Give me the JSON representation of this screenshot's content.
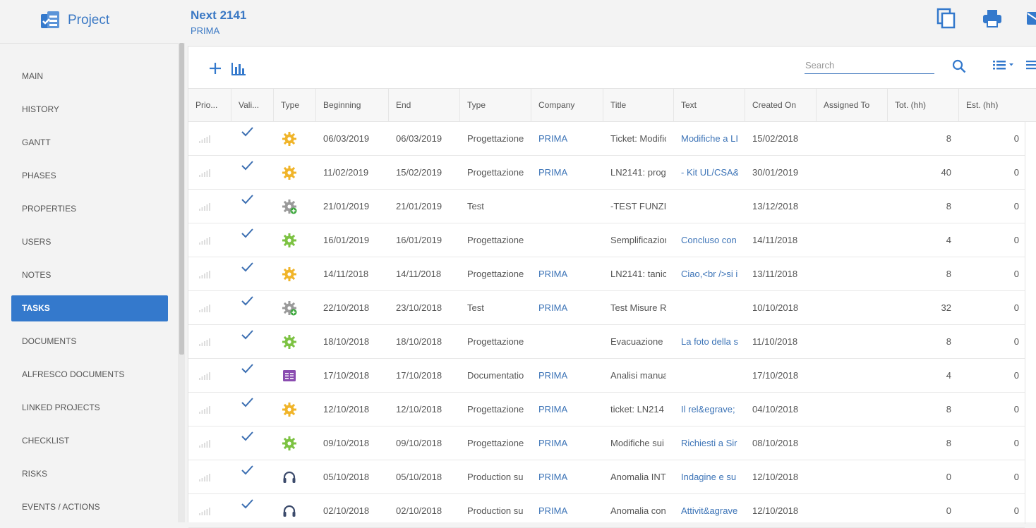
{
  "header": {
    "app_name": "Project",
    "project_title": "Next 2141",
    "project_subtitle": "PRIMA",
    "icons": [
      "copy-icon",
      "print-icon",
      "mail-icon"
    ]
  },
  "sidebar": {
    "items": [
      {
        "label": "MAIN",
        "active": false
      },
      {
        "label": "HISTORY",
        "active": false
      },
      {
        "label": "GANTT",
        "active": false
      },
      {
        "label": "PHASES",
        "active": false
      },
      {
        "label": "PROPERTIES",
        "active": false
      },
      {
        "label": "USERS",
        "active": false
      },
      {
        "label": "NOTES",
        "active": false
      },
      {
        "label": "TASKS",
        "active": true
      },
      {
        "label": "DOCUMENTS",
        "active": false
      },
      {
        "label": "ALFRESCO DOCUMENTS",
        "active": false
      },
      {
        "label": "LINKED PROJECTS",
        "active": false
      },
      {
        "label": "CHECKLIST",
        "active": false
      },
      {
        "label": "RISKS",
        "active": false
      },
      {
        "label": "EVENTS / ACTIONS",
        "active": false
      }
    ]
  },
  "toolbar": {
    "icons": [
      "add-icon",
      "bar-chart-icon",
      "search-icon",
      "list-view-icon",
      "menu-icon"
    ],
    "search_placeholder": "Search"
  },
  "colors": {
    "accent": "#3479cc",
    "link": "#3d74b7",
    "gear_orange": "#f0b429",
    "gear_green": "#7cc242",
    "gear_gray": "#9a9a9a",
    "doc_purple": "#8a4cb0",
    "support_navy": "#3b4a6b"
  },
  "table": {
    "columns": [
      "Prio...",
      "Vali...",
      "Type",
      "Beginning",
      "End",
      "Type",
      "Company",
      "Title",
      "Text",
      "Created On",
      "Assigned To",
      "Tot. (hh)",
      "Est. (hh)"
    ],
    "rows": [
      {
        "icon": "gear-orange",
        "beginning": "06/03/2019",
        "end": "06/03/2019",
        "type": "Progettazione",
        "company": "PRIMA",
        "title": "Ticket: Modific",
        "text": "Modifiche a LI",
        "created": "15/02/2018",
        "assigned": "",
        "tot": "8",
        "est": "0"
      },
      {
        "icon": "gear-orange",
        "beginning": "11/02/2019",
        "end": "15/02/2019",
        "type": "Progettazione",
        "company": "PRIMA",
        "title": "LN2141: prog",
        "text": "- Kit UL/CSA&",
        "created": "30/01/2019",
        "assigned": "",
        "tot": "40",
        "est": "0"
      },
      {
        "icon": "gear-test",
        "beginning": "21/01/2019",
        "end": "21/01/2019",
        "type": "Test",
        "company": "",
        "title": "-TEST FUNZI",
        "text": "",
        "created": "13/12/2018",
        "assigned": "",
        "tot": "8",
        "est": "0"
      },
      {
        "icon": "gear-green",
        "beginning": "16/01/2019",
        "end": "16/01/2019",
        "type": "Progettazione",
        "company": "",
        "title": "Semplificazior",
        "text": "Concluso con",
        "created": "14/11/2018",
        "assigned": "",
        "tot": "4",
        "est": "0"
      },
      {
        "icon": "gear-orange",
        "beginning": "14/11/2018",
        "end": "14/11/2018",
        "type": "Progettazione",
        "company": "PRIMA",
        "title": "LN2141: tanic",
        "text": "Ciao,<br />si i",
        "created": "13/11/2018",
        "assigned": "",
        "tot": "8",
        "est": "0"
      },
      {
        "icon": "gear-test",
        "beginning": "22/10/2018",
        "end": "23/10/2018",
        "type": "Test",
        "company": "PRIMA",
        "title": "Test Misure R",
        "text": "",
        "created": "10/10/2018",
        "assigned": "",
        "tot": "32",
        "est": "0"
      },
      {
        "icon": "gear-green",
        "beginning": "18/10/2018",
        "end": "18/10/2018",
        "type": "Progettazione",
        "company": "",
        "title": "Evacuazione",
        "text": "La foto della s",
        "created": "11/10/2018",
        "assigned": "",
        "tot": "8",
        "est": "0"
      },
      {
        "icon": "document",
        "beginning": "17/10/2018",
        "end": "17/10/2018",
        "type": "Documentatio",
        "company": "PRIMA",
        "title": "Analisi manua",
        "text": "",
        "created": "17/10/2018",
        "assigned": "",
        "tot": "4",
        "est": "0"
      },
      {
        "icon": "gear-orange",
        "beginning": "12/10/2018",
        "end": "12/10/2018",
        "type": "Progettazione",
        "company": "PRIMA",
        "title": "ticket: LN214",
        "text": "Il rel&egrave;",
        "created": "04/10/2018",
        "assigned": "",
        "tot": "8",
        "est": "0"
      },
      {
        "icon": "gear-green",
        "beginning": "09/10/2018",
        "end": "09/10/2018",
        "type": "Progettazione",
        "company": "PRIMA",
        "title": "Modifiche sui",
        "text": "Richiesti a Sir",
        "created": "08/10/2018",
        "assigned": "",
        "tot": "8",
        "est": "0"
      },
      {
        "icon": "headset",
        "beginning": "05/10/2018",
        "end": "05/10/2018",
        "type": "Production su",
        "company": "PRIMA",
        "title": "Anomalia INT",
        "text": "Indagine e su",
        "created": "12/10/2018",
        "assigned": "",
        "tot": "0",
        "est": "0"
      },
      {
        "icon": "headset",
        "beginning": "02/10/2018",
        "end": "02/10/2018",
        "type": "Production su",
        "company": "PRIMA",
        "title": "Anomalia con",
        "text": "Attivit&agrave",
        "created": "12/10/2018",
        "assigned": "",
        "tot": "0",
        "est": "0"
      }
    ]
  }
}
